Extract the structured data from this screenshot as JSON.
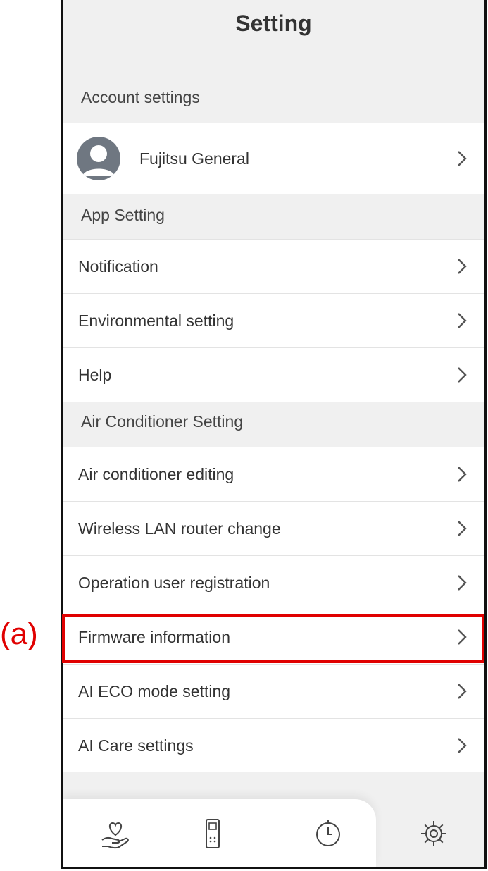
{
  "annotation": {
    "label": "(a)",
    "color": "#e00000"
  },
  "header": {
    "title": "Setting"
  },
  "sections": {
    "account": "Account settings",
    "app": "App Setting",
    "ac": "Air Conditioner Setting"
  },
  "account": {
    "name": "Fujitsu General"
  },
  "app_items": [
    "Notification",
    "Environmental setting",
    "Help"
  ],
  "ac_items": [
    "Air conditioner editing",
    "Wireless LAN router change",
    "Operation user registration",
    "Firmware information",
    "AI ECO mode setting",
    "AI Care settings"
  ],
  "tabbar": {
    "tabs": [
      "heart-hand-icon",
      "remote-control-icon",
      "timer-icon",
      "gear-icon"
    ],
    "active": "gear-icon"
  }
}
